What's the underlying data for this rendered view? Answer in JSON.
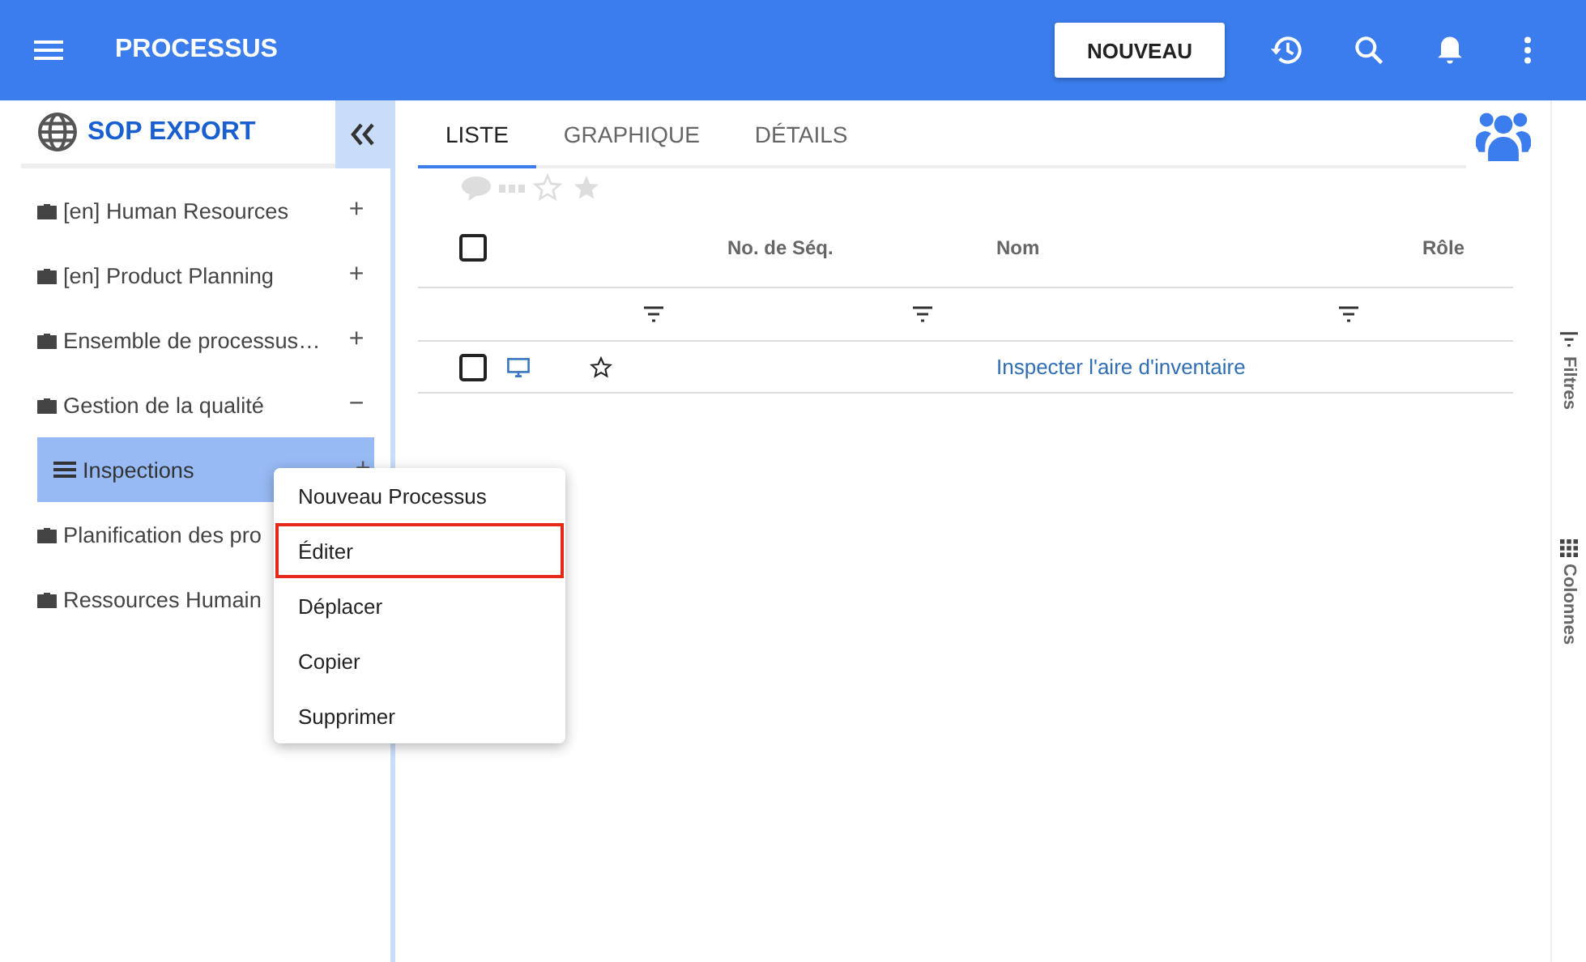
{
  "app_bar": {
    "title": "PROCESSUS",
    "new_button": "NOUVEAU"
  },
  "sidebar": {
    "title": "SOP EXPORT",
    "items": [
      {
        "label": "[en] Human Resources",
        "toggle": "+",
        "selected": false
      },
      {
        "label": "[en] Product Planning",
        "toggle": "+",
        "selected": false
      },
      {
        "label": "Ensemble de processus…",
        "toggle": "+",
        "selected": false
      },
      {
        "label": "Gestion de la qualité",
        "toggle": "−",
        "selected": false,
        "children": [
          {
            "label": "Inspections",
            "toggle": "+",
            "selected": true
          }
        ]
      },
      {
        "label": "Planification des pro",
        "selected": false
      },
      {
        "label": "Ressources Humain",
        "selected": false
      }
    ]
  },
  "context_menu": [
    {
      "label": "Nouveau Processus",
      "selected": false
    },
    {
      "label": "Éditer",
      "selected": true
    },
    {
      "label": "Déplacer",
      "selected": false
    },
    {
      "label": "Copier",
      "selected": false
    },
    {
      "label": "Supprimer",
      "selected": false
    }
  ],
  "tabs": [
    {
      "label": "LISTE",
      "selected": true
    },
    {
      "label": "GRAPHIQUE",
      "selected": false
    },
    {
      "label": "DÉTAILS",
      "selected": false
    }
  ],
  "table": {
    "all_checked": false,
    "columns": [
      "No. de Séq.",
      "Nom",
      "Rôle"
    ],
    "rows": [
      {
        "checked": false,
        "starred": false,
        "name": "Inspecter l'aire d'inventaire"
      }
    ]
  },
  "side_tabs": [
    "Filtres",
    "Colonnes"
  ]
}
